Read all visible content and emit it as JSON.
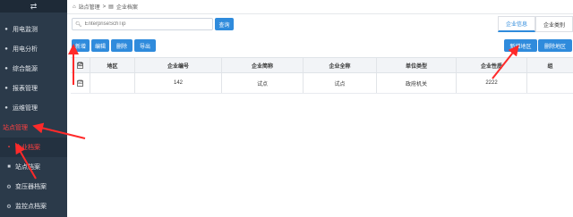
{
  "sidebar": {
    "toggle_icon": "⇄",
    "items": [
      {
        "label": "用电监测",
        "icon": "monitor-icon"
      },
      {
        "label": "用电分析",
        "icon": "analysis-icon"
      },
      {
        "label": "综合能源",
        "icon": "energy-icon"
      },
      {
        "label": "报表管理",
        "icon": "report-icon"
      },
      {
        "label": "运维管理",
        "icon": "maintenance-icon"
      },
      {
        "label": "站点管理",
        "icon": "site-icon"
      }
    ],
    "subitems": [
      {
        "label": "企业档案",
        "icon": "file-icon"
      },
      {
        "label": "站点档案",
        "icon": "bookmark-icon"
      },
      {
        "label": "变压器档案",
        "icon": "gear-icon"
      },
      {
        "label": "监控点档案",
        "icon": "gear-icon"
      }
    ]
  },
  "breadcrumb": {
    "home": "站点管理",
    "sep": ">",
    "current": "企业档案"
  },
  "search": {
    "placeholder": "EnterpriseSchTip",
    "button": "查询"
  },
  "tabs": [
    {
      "label": "企业信息"
    },
    {
      "label": "企业类别"
    }
  ],
  "toolbar": {
    "add": "新增",
    "edit": "编辑",
    "delete": "删除",
    "export": "导出",
    "add_area": "新增地区",
    "delete_area": "删除地区"
  },
  "table": {
    "headers": [
      "",
      "地区",
      "企业编号",
      "企业简称",
      "企业全称",
      "单位类型",
      "企业性质",
      "组"
    ],
    "rows": [
      {
        "check": "☑",
        "area": "",
        "code": "142",
        "short": "试点",
        "full": "试点",
        "type": "政府机关",
        "nature": "2222",
        "extra": ""
      }
    ]
  },
  "colors": {
    "sidebar": "#2b3a4a",
    "accent": "#2f8bdc",
    "arrow": "#ff2a2a"
  }
}
